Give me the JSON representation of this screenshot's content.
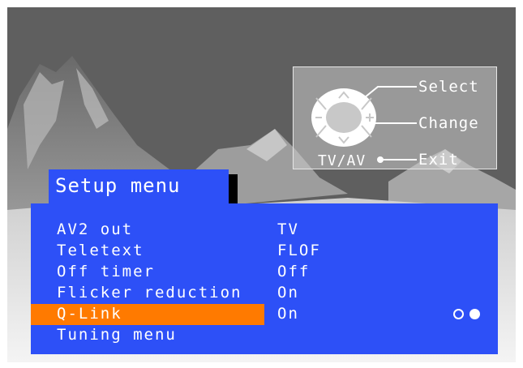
{
  "help_overlay": {
    "select_label": "Select",
    "change_label": "Change",
    "exit_label": "Exit",
    "source_label": "TV/AV"
  },
  "menu": {
    "title": "Setup menu",
    "selected_index": 4,
    "items": [
      {
        "label": "AV2 out",
        "value": "TV"
      },
      {
        "label": "Teletext",
        "value": "FLOF"
      },
      {
        "label": "Off timer",
        "value": "Off"
      },
      {
        "label": "Flicker reduction",
        "value": "On"
      },
      {
        "label": "Q-Link",
        "value": "On"
      },
      {
        "label": "Tuning menu",
        "value": ""
      }
    ]
  },
  "colors": {
    "menu_blue": "#2d50f7",
    "highlight_orange": "#ff7a00"
  },
  "icons": {
    "cursor_pad": "navigation-pad-icon",
    "toggle_off": "radio-empty-icon",
    "toggle_on": "radio-filled-icon"
  }
}
